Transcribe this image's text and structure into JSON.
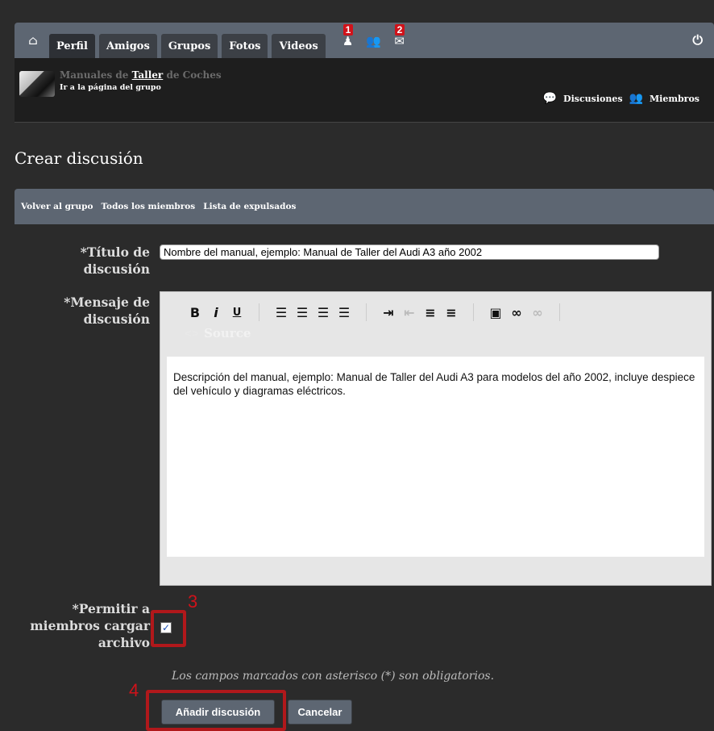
{
  "nav": {
    "home_icon": "home-icon",
    "tabs": [
      {
        "label": "Perfil"
      },
      {
        "label": "Amigos"
      },
      {
        "label": "Grupos"
      },
      {
        "label": "Fotos"
      },
      {
        "label": "Videos"
      }
    ],
    "notifications_badge": "1",
    "messages_badge": "2",
    "power_icon": "power-icon"
  },
  "group": {
    "name_prefix": "Manuales de ",
    "name_highlight": "Taller",
    "name_suffix": " de Coches",
    "link": "Ir a la página del grupo",
    "discussions": "Discusiones",
    "members": "Miembros"
  },
  "page": {
    "title": "Crear discusión"
  },
  "subnav": {
    "items": [
      "Volver al grupo",
      "Todos los miembros",
      "Lista de expulsados"
    ]
  },
  "form": {
    "title_label_1": "*Título de",
    "title_label_2": "discusión",
    "title_value": "Nombre del manual, ejemplo: Manual de Taller del Audi A3 año 2002",
    "message_label_1": "*Mensaje de",
    "message_label_2": "discusión",
    "message_value": "Descripción del manual, ejemplo: Manual de Taller del Audi A3 para modelos del año 2002, incluye despiece del vehículo y diagramas eléctricos.",
    "source_label": "Source",
    "upload_label_1": "*Permitir a",
    "upload_label_2": "miembros cargar",
    "upload_label_3": "archivo",
    "upload_checked": true,
    "required_hint": "Los campos marcados con asterisco (*) son obligatorios.",
    "submit_label": "Añadir discusión",
    "cancel_label": "Cancelar"
  },
  "annotations": {
    "step3": "3",
    "step4": "4",
    "color": "#d0121a"
  },
  "colors": {
    "nav_bg": "#5d6672",
    "page_bg": "#2b2b2b",
    "tab_bg": "#3c4046"
  }
}
